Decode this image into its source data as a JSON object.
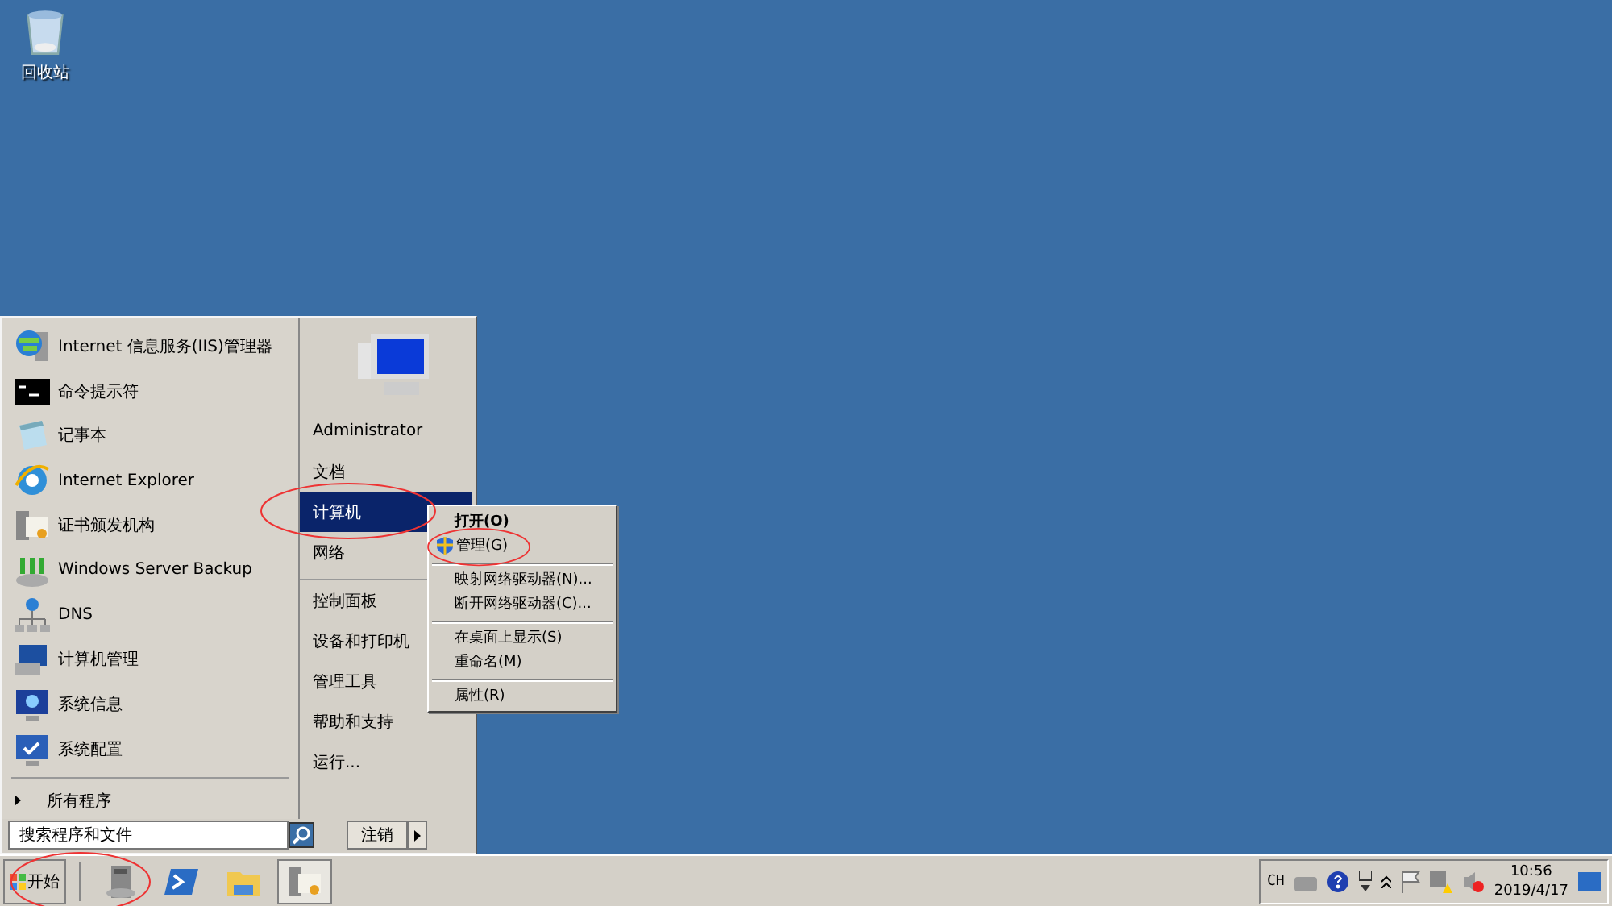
{
  "desktop_icons": [
    {
      "label": "回收站",
      "kind": "recycle"
    }
  ],
  "start_menu": {
    "programs": [
      {
        "label": "Internet 信息服务(IIS)管理器",
        "kind": "iis"
      },
      {
        "label": "命令提示符",
        "kind": "cmd"
      },
      {
        "label": "记事本",
        "kind": "notepad"
      },
      {
        "label": "Internet Explorer",
        "kind": "ie"
      },
      {
        "label": "证书颁发机构",
        "kind": "cert"
      },
      {
        "label": "Windows Server Backup",
        "kind": "backup"
      },
      {
        "label": "DNS",
        "kind": "dns"
      },
      {
        "label": "计算机管理",
        "kind": "compmgmt"
      },
      {
        "label": "系统信息",
        "kind": "sysinfo"
      },
      {
        "label": "系统配置",
        "kind": "sysconfig"
      }
    ],
    "all_programs": "所有程序",
    "search": {
      "placeholder": "搜索程序和文件"
    },
    "user": "Administrator",
    "places": [
      {
        "label": "文档",
        "selected": false,
        "separator_before": false
      },
      {
        "label": "计算机",
        "selected": true,
        "separator_before": false
      },
      {
        "label": "网络",
        "selected": false,
        "separator_before": false
      },
      {
        "label": "控制面板",
        "selected": false,
        "separator_before": true
      },
      {
        "label": "设备和打印机",
        "selected": false,
        "separator_before": false
      },
      {
        "label": "管理工具",
        "selected": false,
        "separator_before": false
      },
      {
        "label": "帮助和支持",
        "selected": false,
        "separator_before": false
      },
      {
        "label": "运行...",
        "selected": false,
        "separator_before": false
      }
    ],
    "logoff": "注销"
  },
  "context_menu": {
    "items": [
      {
        "label": "打开(O)",
        "default": true,
        "shield": false,
        "separator_before": false
      },
      {
        "label": "管理(G)",
        "default": false,
        "shield": true,
        "separator_before": false
      },
      {
        "label": "映射网络驱动器(N)...",
        "default": false,
        "shield": false,
        "separator_before": true
      },
      {
        "label": "断开网络驱动器(C)...",
        "default": false,
        "shield": false,
        "separator_before": false
      },
      {
        "label": "在桌面上显示(S)",
        "default": false,
        "shield": false,
        "separator_before": true
      },
      {
        "label": "重命名(M)",
        "default": false,
        "shield": false,
        "separator_before": false
      },
      {
        "label": "属性(R)",
        "default": false,
        "shield": false,
        "separator_before": true
      }
    ]
  },
  "taskbar": {
    "start": "开始",
    "apps": [
      {
        "kind": "server",
        "selected": false
      },
      {
        "kind": "powershell",
        "selected": false
      },
      {
        "kind": "explorer",
        "selected": false
      },
      {
        "kind": "cert",
        "selected": true
      }
    ],
    "tray": {
      "language": "CH",
      "time": "10:56",
      "date": "2019/4/17"
    }
  }
}
